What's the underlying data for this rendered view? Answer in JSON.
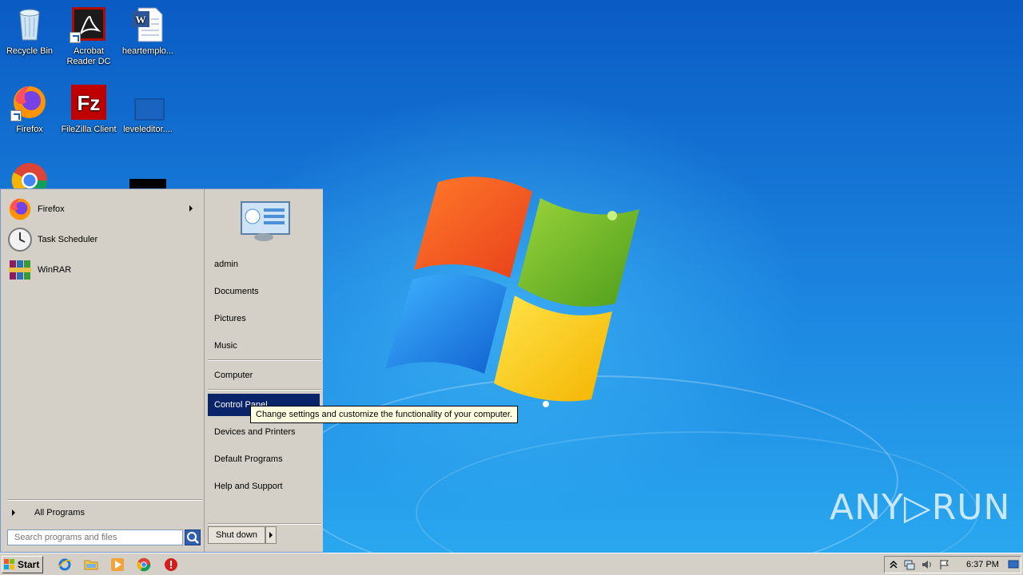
{
  "desktop": {
    "icons": [
      {
        "label": "Recycle Bin",
        "icon": "recycle-bin-icon"
      },
      {
        "label": "Acrobat Reader DC",
        "icon": "acrobat-icon"
      },
      {
        "label": "heartemplo...",
        "icon": "word-document-icon"
      },
      {
        "label": "Firefox",
        "icon": "firefox-icon"
      },
      {
        "label": "FileZilla Client",
        "icon": "filezilla-icon"
      },
      {
        "label": "leveleditor....",
        "icon": "file-icon"
      }
    ],
    "watermark": "ANY▷RUN"
  },
  "start_menu": {
    "programs": [
      {
        "label": "Firefox",
        "icon": "firefox-icon",
        "has_submenu": true
      },
      {
        "label": "Task Scheduler",
        "icon": "clock-icon",
        "has_submenu": false
      },
      {
        "label": "WinRAR",
        "icon": "winrar-icon",
        "has_submenu": false
      }
    ],
    "all_programs": "All Programs",
    "search_placeholder": "Search programs and files",
    "places": [
      {
        "label": "admin"
      },
      {
        "label": "Documents"
      },
      {
        "label": "Pictures"
      },
      {
        "label": "Music"
      },
      {
        "label": "Computer"
      },
      {
        "label": "Control Panel",
        "selected": true
      },
      {
        "label": "Devices and Printers"
      },
      {
        "label": "Default Programs"
      },
      {
        "label": "Help and Support"
      }
    ],
    "shutdown_label": "Shut down"
  },
  "tooltip": {
    "text": "Change settings and customize the functionality of your computer."
  },
  "taskbar": {
    "start_label": "Start",
    "pinned": [
      "internet-explorer-icon",
      "folder-icon",
      "media-player-icon",
      "chrome-icon",
      "stop-icon"
    ],
    "clock": "6:37 PM"
  },
  "colors": {
    "selection": "#0a246a",
    "menu_bg": "#d4d0c8",
    "tooltip_bg": "#ffffe1"
  }
}
